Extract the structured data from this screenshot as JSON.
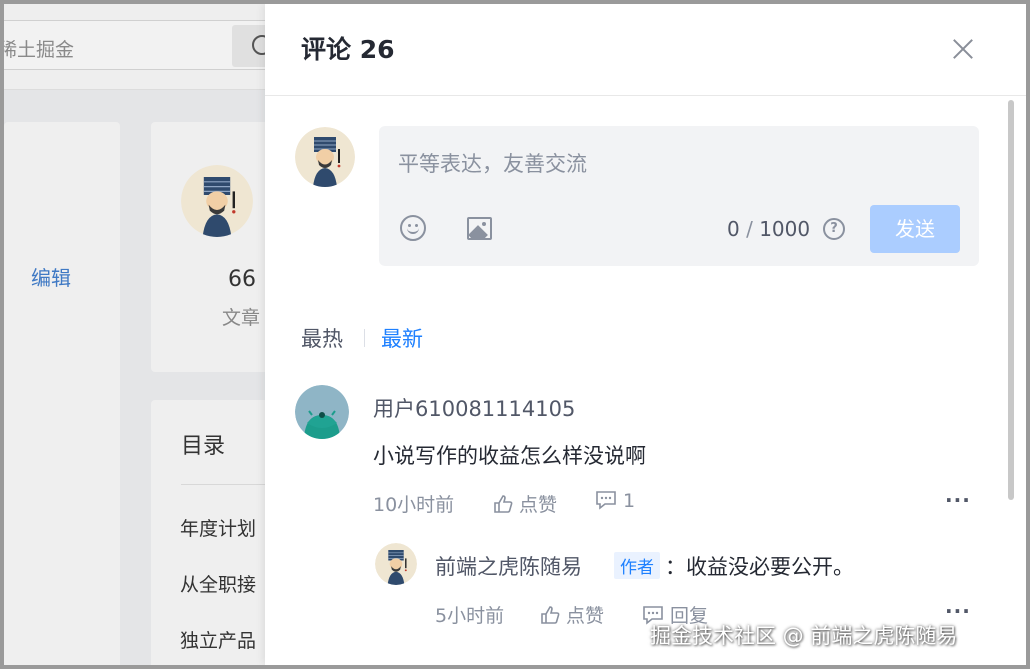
{
  "background": {
    "search_placeholder": "稀土掘金",
    "edit_label": "编辑",
    "profile": {
      "count": "66",
      "count_label": "文章"
    },
    "toc": {
      "title": "目录",
      "items": [
        "年度计划",
        "从全职接",
        "独立产品"
      ]
    }
  },
  "drawer": {
    "title": "评论 26",
    "input": {
      "placeholder": "平等表达，友善交流",
      "count": "0",
      "max": "1000",
      "send_label": "发送"
    },
    "sort": {
      "hot": "最热",
      "new": "最新"
    },
    "comments": [
      {
        "user": "用户610081114105",
        "text": "小说写作的收益怎么样没说啊",
        "time": "10小时前",
        "like_label": "点赞",
        "reply_count": "1",
        "more": "···",
        "replies": [
          {
            "user": "前端之虎陈随易",
            "badge": "作者",
            "text": "：收益没必要公开。",
            "time": "5小时前",
            "like_label": "点赞",
            "reply_label": "回复",
            "more": "···"
          }
        ]
      }
    ]
  },
  "watermark": "掘金技术社区 @ 前端之虎陈随易",
  "colors": {
    "accent": "#1e80ff",
    "send_disabled": "#abcdff",
    "text_primary": "#252933",
    "text_secondary": "#8a919f"
  }
}
